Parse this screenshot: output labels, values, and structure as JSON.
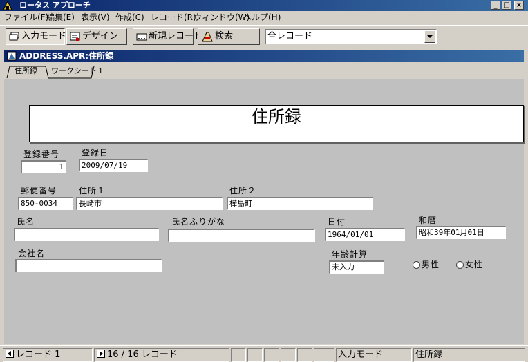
{
  "app": {
    "title": "ロータス アプローチ"
  },
  "menu": [
    "ファイル(F)",
    "編集(E)",
    "表示(V)",
    "作成(C)",
    "レコード(R)",
    "ウィンドウ(W)",
    "ヘルプ(H)"
  ],
  "toolbar": {
    "browse_label": "入力モード",
    "design_label": "デザイン",
    "new_record_label": "新規レコード",
    "find_label": "検索",
    "found_set_value": "全レコード"
  },
  "window": {
    "title": "ADDRESS.APR:住所録",
    "tabs": [
      "住所録",
      "ワークシート１"
    ]
  },
  "form": {
    "heading": "住所録",
    "fields": {
      "reg_no": {
        "label": "登録番号",
        "value": "1"
      },
      "reg_date": {
        "label": "登録日",
        "value": "2009/07/19"
      },
      "postal": {
        "label": "郵便番号",
        "value": "850-0034"
      },
      "address1": {
        "label": "住所１",
        "value": "長崎市"
      },
      "address2": {
        "label": "住所２",
        "value": "樺島町"
      },
      "name": {
        "label": "氏名",
        "value": ""
      },
      "name_kana": {
        "label": "氏名ふりがな",
        "value": ""
      },
      "date": {
        "label": "日付",
        "value": "1964/01/01"
      },
      "wareki": {
        "label": "和暦",
        "value": "昭和39年01月01日"
      },
      "company": {
        "label": "会社名",
        "value": ""
      },
      "age": {
        "label": "年齢計算",
        "value": "未入力"
      }
    },
    "gender": {
      "male": "男性",
      "female": "女性"
    }
  },
  "status": {
    "record_label": "レコード 1",
    "record_count": "16 / 16 レコード",
    "mode": "入力モード",
    "view": "住所録"
  },
  "colors": {
    "title_bar_start": "#0a246a",
    "title_bar_end": "#3a6ea5",
    "face": "#d4d0c8",
    "form_bg": "#c0c0c0"
  }
}
